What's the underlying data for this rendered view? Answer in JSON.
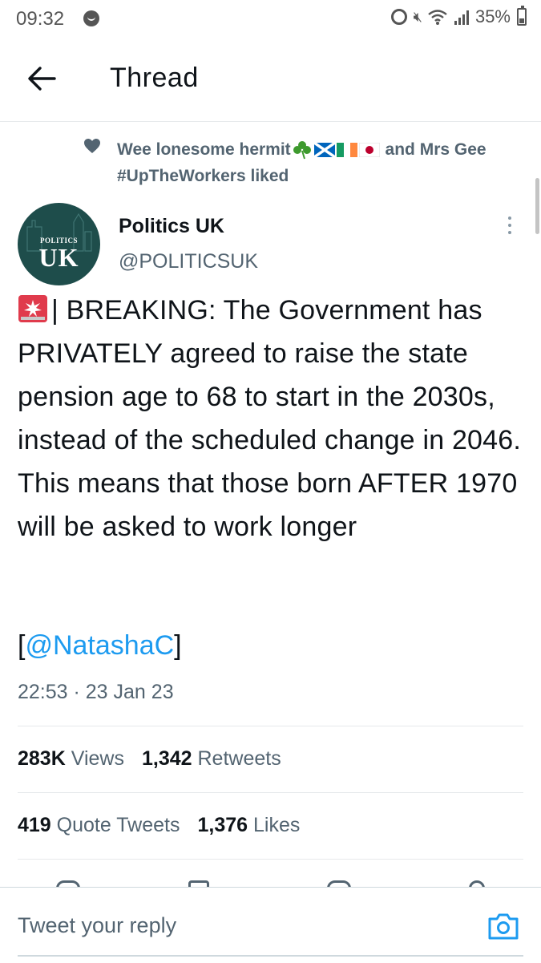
{
  "status_bar": {
    "time": "09:32",
    "battery": "35%",
    "icons": [
      "notification-icon",
      "alarm-icon",
      "mute-icon",
      "wifi-icon",
      "signal-icon",
      "battery-icon"
    ]
  },
  "header": {
    "back_icon": "arrow-left-icon",
    "title": "Thread"
  },
  "social_context": {
    "icon": "heart-icon",
    "user1": "Wee lonesome hermit",
    "user1_flags": [
      "shamrock",
      "scotland-flag",
      "ireland-flag",
      "japan-flag"
    ],
    "conjunction": " and ",
    "user2": "Mrs Gee",
    "user2_tag": "#UpTheWorkers",
    "action": " liked"
  },
  "tweet": {
    "author": {
      "name": "Politics UK",
      "handle": "@POLITICSUK",
      "avatar_small_text": "POLITICS",
      "avatar_big_text": "UK",
      "avatar_color": "#1e4d4b"
    },
    "emoji": "rotating-light-icon",
    "text": "| BREAKING: The Government has PRIVATELY agreed to raise the state pension age to 68 to start in the 2030s, instead of the scheduled change in 2046. This means that those born AFTER 1970 will be asked to work longer",
    "mention_open": "[",
    "mention": "@NatashaC",
    "mention_close": "]",
    "timestamp": "22:53 · 23 Jan 23",
    "stats": {
      "views_count": "283K",
      "views_label": "Views",
      "retweets_count": "1,342",
      "retweets_label": "Retweets",
      "quotes_count": "419",
      "quotes_label": "Quote Tweets",
      "likes_count": "1,376",
      "likes_label": "Likes"
    }
  },
  "reply_bar": {
    "placeholder": "Tweet your reply",
    "camera_icon": "camera-icon"
  },
  "colors": {
    "link": "#1d9bf0",
    "secondary_text": "#536471",
    "primary_text": "#0f1419",
    "divider": "#e6e9eb"
  }
}
